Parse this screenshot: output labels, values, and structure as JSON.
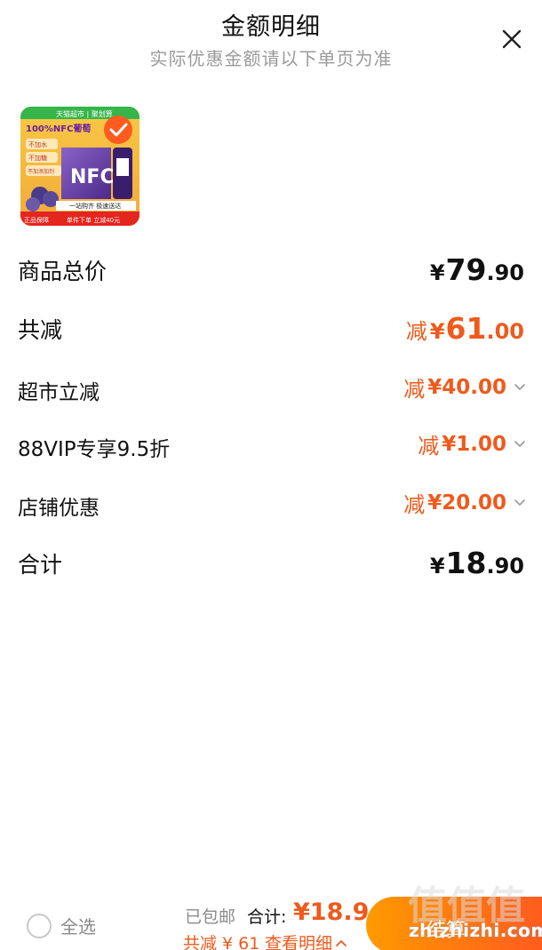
{
  "header": {
    "title": "金额明细",
    "subtitle": "实际优惠金额请以下单页为准"
  },
  "product": {
    "image": {
      "top_banner": "天猫超市 | 聚划算",
      "headline": "100%NFC葡萄",
      "tag_1": "不加水",
      "tag_2": "不加糖",
      "tag_3": "不加添加剂",
      "box_logo": "NFC",
      "strip": "一站购齐 极速送达",
      "bottom_left": "正品保障",
      "bottom_right": "单件下单 立减40元"
    }
  },
  "rows": {
    "total_price": {
      "label": "商品总价",
      "yen": "¥",
      "int": "79",
      "dec": ".90"
    },
    "total_discount": {
      "label": "共减",
      "prefix": "减",
      "yen": "¥",
      "int": "61",
      "dec": ".00"
    },
    "supermarket": {
      "label": "超市立减",
      "prefix": "减",
      "amount": "¥40.00"
    },
    "vip": {
      "label": "88VIP专享9.5折",
      "prefix": "减",
      "amount": "¥1.00"
    },
    "store": {
      "label": "店铺优惠",
      "prefix": "减",
      "amount": "¥20.00"
    },
    "sum": {
      "label": "合计",
      "yen": "¥",
      "int": "18",
      "dec": ".90"
    }
  },
  "footer": {
    "select_all": "全选",
    "shipping": "已包邮",
    "total_label": "合计:",
    "total_amount": "¥18.9",
    "saved": "共减 ¥ 61",
    "detail_link": "查看明细",
    "checkout": "结算"
  },
  "watermark": {
    "text": "zhizhizhi.com",
    "glyphs": "值值值"
  },
  "colors": {
    "accent": "#ef5a1c",
    "checkout_start": "#ff9a00",
    "checkout_end": "#ff5b1f",
    "muted": "#9a9a9a"
  }
}
